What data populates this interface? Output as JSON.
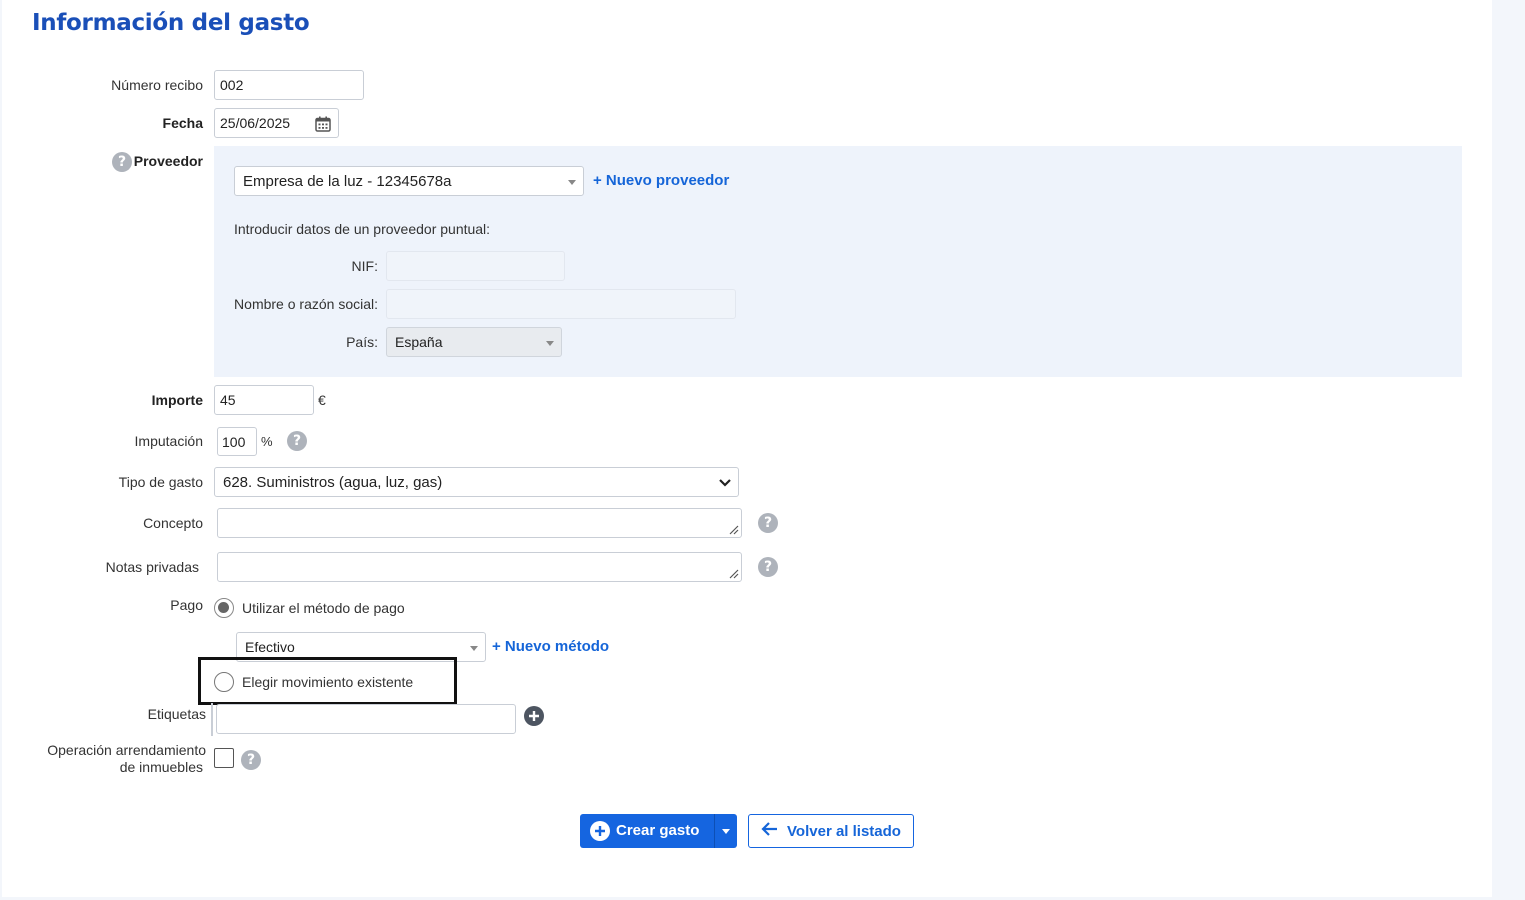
{
  "page": {
    "title": "Información del gasto"
  },
  "form": {
    "receipt": {
      "label": "Número recibo",
      "value": "002"
    },
    "date": {
      "label": "Fecha",
      "value": "25/06/2025"
    },
    "supplier": {
      "label": "Proveedor",
      "selected": "Empresa de la luz - 12345678a",
      "new_link": "+ Nuevo proveedor",
      "occasional_title": "Introducir datos de un proveedor puntual:",
      "nif_label": "NIF:",
      "nif_value": "",
      "name_label": "Nombre o razón social:",
      "name_value": "",
      "country_label": "País:",
      "country_value": "España"
    },
    "amount": {
      "label": "Importe",
      "value": "45",
      "currency": "€"
    },
    "imputation": {
      "label": "Imputación",
      "value": "100",
      "unit": "%"
    },
    "expense_type": {
      "label": "Tipo de gasto",
      "value": "628. Suministros (agua, luz, gas)"
    },
    "concept": {
      "label": "Concepto",
      "value": ""
    },
    "private_notes": {
      "label": "Notas privadas",
      "value": ""
    },
    "payment": {
      "label": "Pago",
      "option_method": "Utilizar el método de pago",
      "method_value": "Efectivo",
      "new_method_link": "+ Nuevo método",
      "option_existing": "Elegir movimiento existente",
      "selected_option": "method"
    },
    "tags": {
      "label": "Etiquetas",
      "value": ""
    },
    "lease": {
      "label_line1": "Operación arrendamiento",
      "label_line2": "de inmuebles",
      "checked": false
    }
  },
  "actions": {
    "create": "Crear gasto",
    "back": "Volver al listado"
  },
  "icons": {
    "help": "question-circle-icon",
    "calendar": "calendar-icon",
    "add": "plus-circle-icon",
    "back": "arrow-left-icon"
  },
  "colors": {
    "primary": "#1565e0",
    "title": "#1a4fb8",
    "supplier_panel": "#eef3fb",
    "help_icon": "#aeb3bb"
  }
}
